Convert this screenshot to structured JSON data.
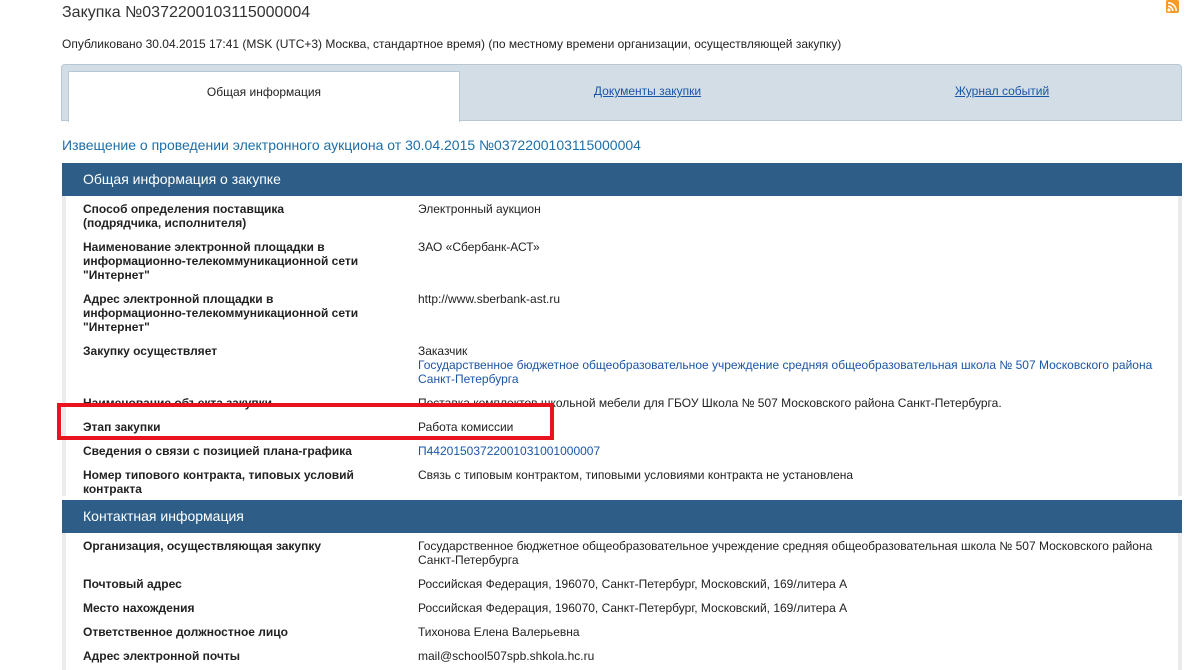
{
  "header": {
    "title": "Закупка №0372200103115000004",
    "published": "Опубликовано 30.04.2015 17:41 (MSK (UTC+3) Москва, стандартное время) (по местному времени организации, осуществляющей закупку)",
    "rss_icon": "rss-icon"
  },
  "tabs": [
    {
      "label": "Общая информация",
      "active": true
    },
    {
      "label": "Документы закупки",
      "active": false
    },
    {
      "label": "Журнал событий",
      "active": false
    }
  ],
  "notice_title": "Извещение о проведении электронного аукциона от 30.04.2015 №0372200103115000004",
  "general": {
    "header": "Общая информация о закупке",
    "rows": [
      {
        "label": "Способ определения поставщика (подрядчика, исполнителя)",
        "value": "Электронный аукцион"
      },
      {
        "label": "Наименование электронной площадки в информационно-телекоммуникационной сети \"Интернет\"",
        "value": "ЗАО «Сбербанк-АСТ»"
      },
      {
        "label": "Адрес электронной площадки в информационно-телекоммуникационной сети \"Интернет\"",
        "value": "http://www.sberbank-ast.ru"
      },
      {
        "label": "Закупку осуществляет",
        "value_prefix": "Заказчик",
        "value": "Государственное бюджетное общеобразовательное учреждение средняя общеобразовательная школа № 507 Московского района Санкт-Петербурга"
      },
      {
        "label": "Наименование объекта закупки",
        "value": "Поставка комплектов школьной мебели для ГБОУ Школа № 507 Московского района Санкт-Петербурга."
      },
      {
        "label": "Этап закупки",
        "value": "Работа комиссии"
      },
      {
        "label": "Сведения о связи с позицией плана-графика",
        "value": "П44201503722001031001000007"
      },
      {
        "label": "Номер типового контракта, типовых условий контракта",
        "value": "Связь с типовым контрактом, типовыми условиями контракта не установлена"
      }
    ]
  },
  "contact": {
    "header": "Контактная информация",
    "rows": [
      {
        "label": "Организация, осуществляющая закупку",
        "value": "Государственное бюджетное общеобразовательное учреждение средняя общеобразовательная школа № 507 Московского района Санкт-Петербурга"
      },
      {
        "label": "Почтовый адрес",
        "value": "Российская Федерация, 196070, Санкт-Петербург, Московский, 169/литера А"
      },
      {
        "label": "Место нахождения",
        "value": "Российская Федерация, 196070, Санкт-Петербург, Московский, 169/литера А"
      },
      {
        "label": "Ответственное должностное лицо",
        "value": "Тихонова Елена Валерьевна"
      },
      {
        "label": "Адрес электронной почты",
        "value": "mail@school507spb.shkola.hc.ru"
      }
    ]
  },
  "colors": {
    "panel_header": "#2e5e88",
    "link": "#1a56a6",
    "highlight": "#e8131f",
    "notice_title": "#1e6fa8"
  }
}
